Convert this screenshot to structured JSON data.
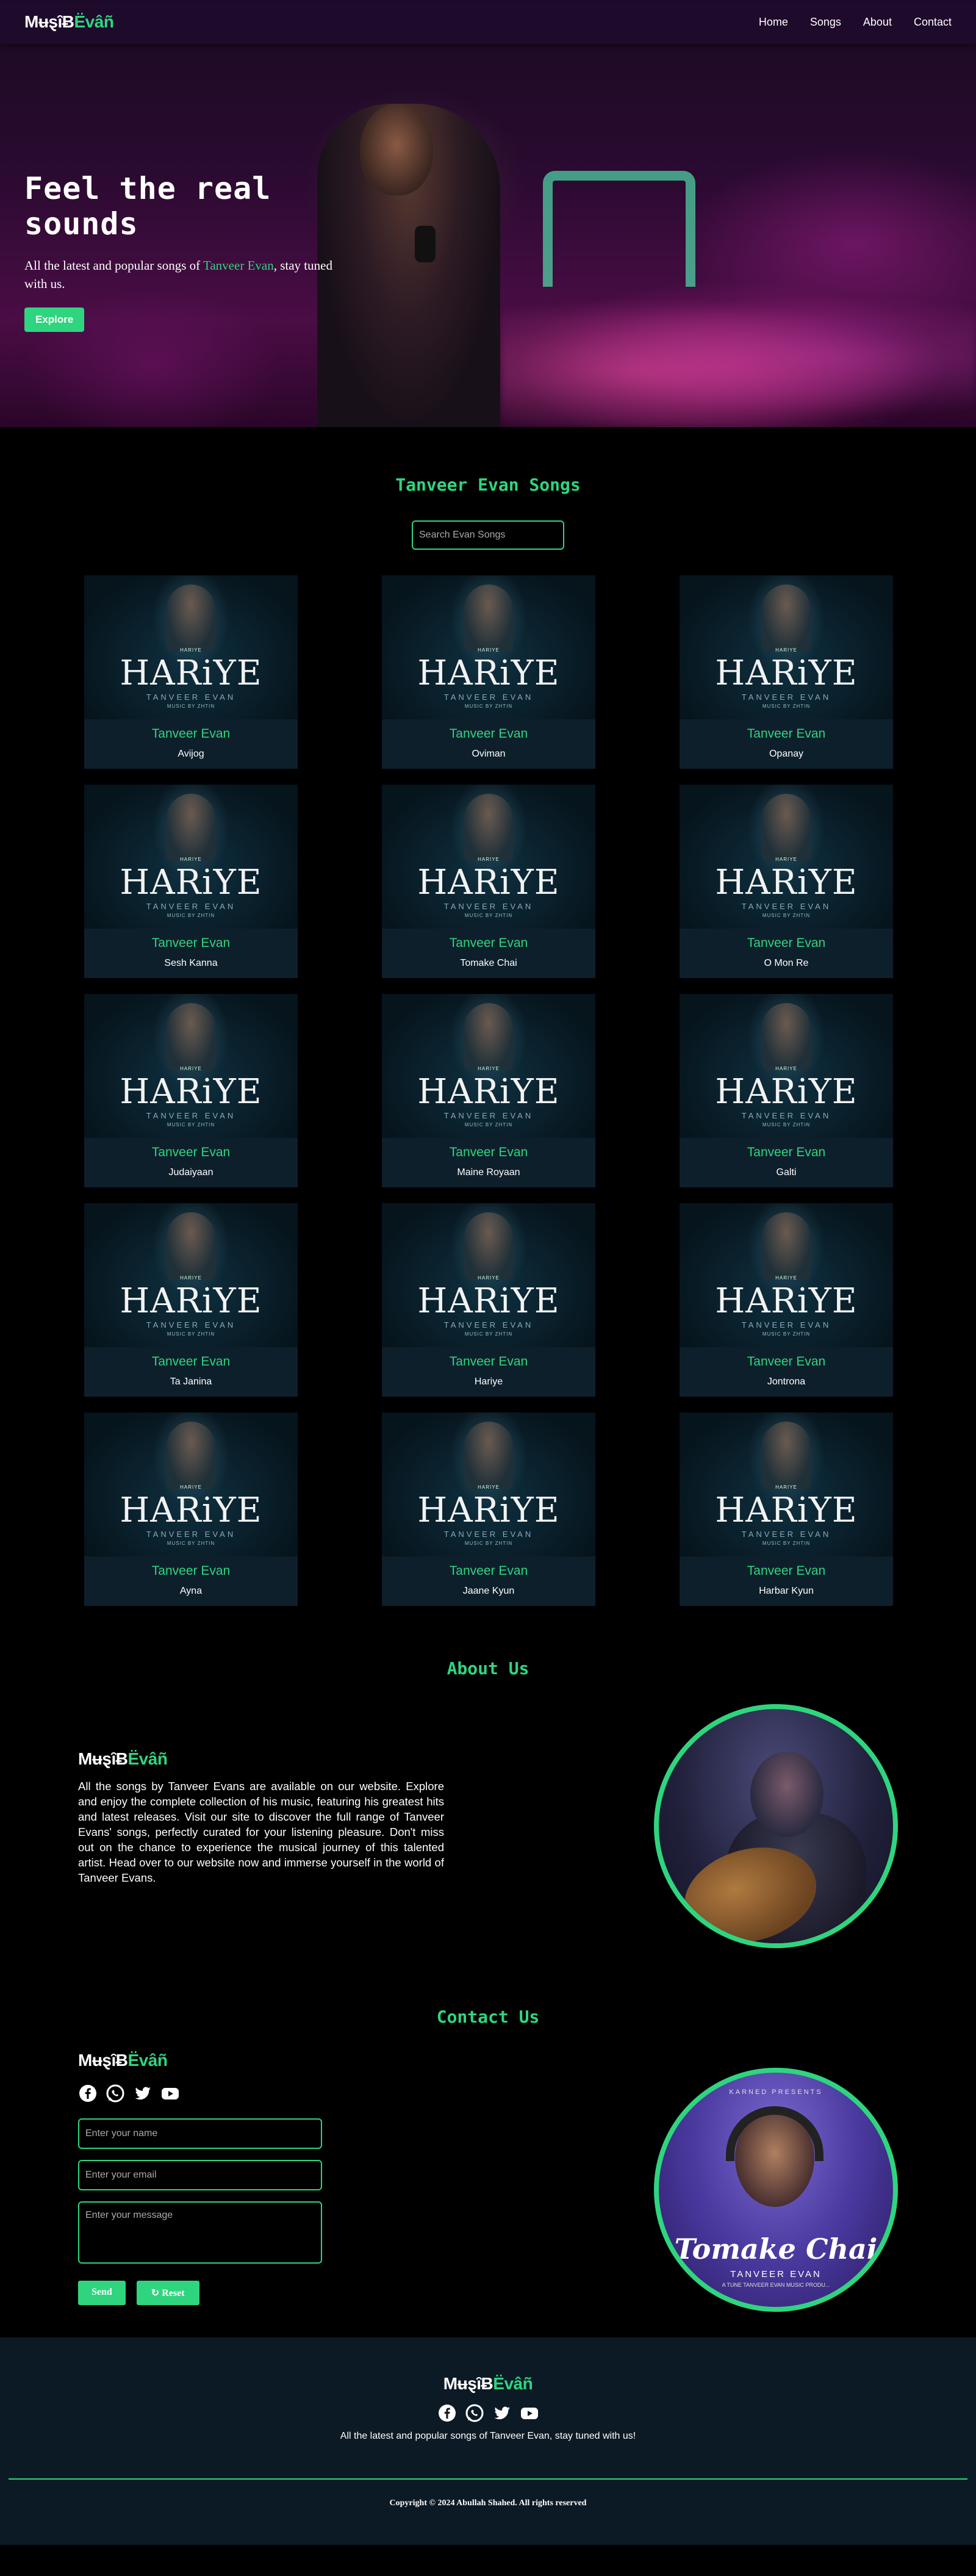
{
  "brand": {
    "part1": "MʉȿȋɃ",
    "part2": "Ëvâñ"
  },
  "nav": {
    "links": [
      "Home",
      "Songs",
      "About",
      "Contact"
    ]
  },
  "hero": {
    "title": "Feel the real sounds",
    "sub_before": "All the latest and popular songs of ",
    "sub_highlight": "Tanveer Evan",
    "sub_after": ", stay tuned with us.",
    "button": "Explore"
  },
  "songs": {
    "title": "Tanveer Evan Songs",
    "search_placeholder": "Search Evan Songs",
    "cover": {
      "small": "HARIYE",
      "big": "HARiYE",
      "artist": "TANVEER EVAN",
      "music": "MUSIC BY ZHTIN"
    },
    "items": [
      {
        "artist": "Tanveer Evan",
        "song": "Avijog"
      },
      {
        "artist": "Tanveer Evan",
        "song": "Oviman"
      },
      {
        "artist": "Tanveer Evan",
        "song": "Opanay"
      },
      {
        "artist": "Tanveer Evan",
        "song": "Sesh Kanna"
      },
      {
        "artist": "Tanveer Evan",
        "song": "Tomake Chai"
      },
      {
        "artist": "Tanveer Evan",
        "song": "O Mon Re"
      },
      {
        "artist": "Tanveer Evan",
        "song": "Judaiyaan"
      },
      {
        "artist": "Tanveer Evan",
        "song": "Maine Royaan"
      },
      {
        "artist": "Tanveer Evan",
        "song": "Galti"
      },
      {
        "artist": "Tanveer Evan",
        "song": "Ta Janina"
      },
      {
        "artist": "Tanveer Evan",
        "song": "Hariye"
      },
      {
        "artist": "Tanveer Evan",
        "song": "Jontrona"
      },
      {
        "artist": "Tanveer Evan",
        "song": "Ayna"
      },
      {
        "artist": "Tanveer Evan",
        "song": "Jaane Kyun"
      },
      {
        "artist": "Tanveer Evan",
        "song": "Harbar Kyun"
      }
    ]
  },
  "about": {
    "title": "About Us",
    "text": "All the songs by Tanveer Evans are available on our website. Explore and enjoy the complete collection of his music, featuring his greatest hits and latest releases. Visit our site to discover the full range of Tanveer Evans' songs, perfectly curated for your listening pleasure. Don't miss out on the chance to experience the musical journey of this talented artist. Head over to our website now and immerse yourself in the world of Tanveer Evans."
  },
  "contact": {
    "title": "Contact Us",
    "name_placeholder": "Enter your name",
    "email_placeholder": "Enter your email",
    "message_placeholder": "Enter your message",
    "send": "Send",
    "reset": "Reset",
    "poster": {
      "top": "KARNED PRESENTS",
      "title": "Tomake Chai",
      "artist": "TANVEER EVAN",
      "small": "A TUNE TANVEER EVAN MUSIC PRODU..."
    }
  },
  "footer": {
    "tagline": "All the latest and popular songs of Tanveer Evan, stay tuned with us!",
    "copyright": "Copyright © 2024 Abullah Shahed. All rights reserved"
  },
  "social_icons": [
    "facebook-icon",
    "whatsapp-icon",
    "twitter-icon",
    "youtube-icon"
  ],
  "colors": {
    "accent": "#2fd57e",
    "card": "#0e1f2c",
    "footer": "#0c1a26"
  }
}
